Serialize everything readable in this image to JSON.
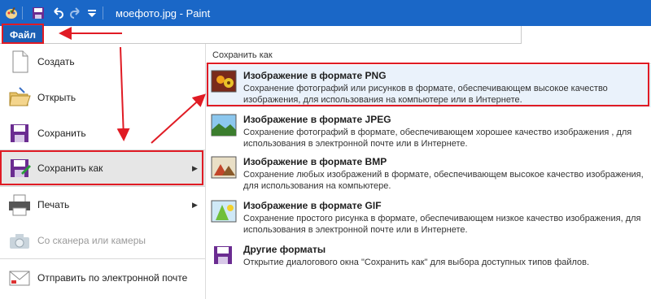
{
  "window": {
    "title": "моефото.jpg - Paint"
  },
  "ribbon": {
    "file_tab": "Файл"
  },
  "menu": {
    "items": [
      {
        "label": "Создать",
        "icon": "new-document-icon",
        "disabled": false
      },
      {
        "label": "Открыть",
        "icon": "open-folder-icon",
        "disabled": false
      },
      {
        "label": "Сохранить",
        "icon": "floppy-save-icon",
        "disabled": false
      },
      {
        "label": "Сохранить как",
        "icon": "save-as-icon",
        "disabled": false,
        "submenu": true
      },
      {
        "label": "Печать",
        "icon": "printer-icon",
        "disabled": false,
        "submenu": true
      },
      {
        "label": "Со сканера или камеры",
        "icon": "scanner-camera-icon",
        "disabled": true
      },
      {
        "label": "Отправить по электронной почте",
        "icon": "email-icon",
        "disabled": false
      }
    ]
  },
  "save_as_panel": {
    "header": "Сохранить как",
    "formats": [
      {
        "name": "Изображение в формате PNG",
        "description": "Сохранение фотографий или рисунков в формате, обеспечивающем высокое качество изображения, для использования на компьютере или в Интернете.",
        "icon": "png-image-icon"
      },
      {
        "name": "Изображение в формате JPEG",
        "description": "Сохранение фотографий в формате, обеспечивающем хорошее качество изображения , для использования в электронной почте или в Интернете.",
        "icon": "jpeg-image-icon"
      },
      {
        "name": "Изображение в формате BMP",
        "description": "Сохранение любых изображений в формате, обеспечивающем высокое качество изображения, для использования на компьютере.",
        "icon": "bmp-image-icon"
      },
      {
        "name": "Изображение в формате GIF",
        "description": "Сохранение простого рисунка в формате, обеспечивающем низкое качество изображения, для использования в электронной почте или в Интернете.",
        "icon": "gif-image-icon"
      },
      {
        "name": "Другие форматы",
        "description": "Открытие диалогового окна \"Сохранить как\" для выбора доступных типов файлов.",
        "icon": "other-formats-icon"
      }
    ]
  },
  "colors": {
    "titlebar": "#1a67c7",
    "file_tab": "#1a5fb4",
    "annotation_red": "#e01b24"
  }
}
